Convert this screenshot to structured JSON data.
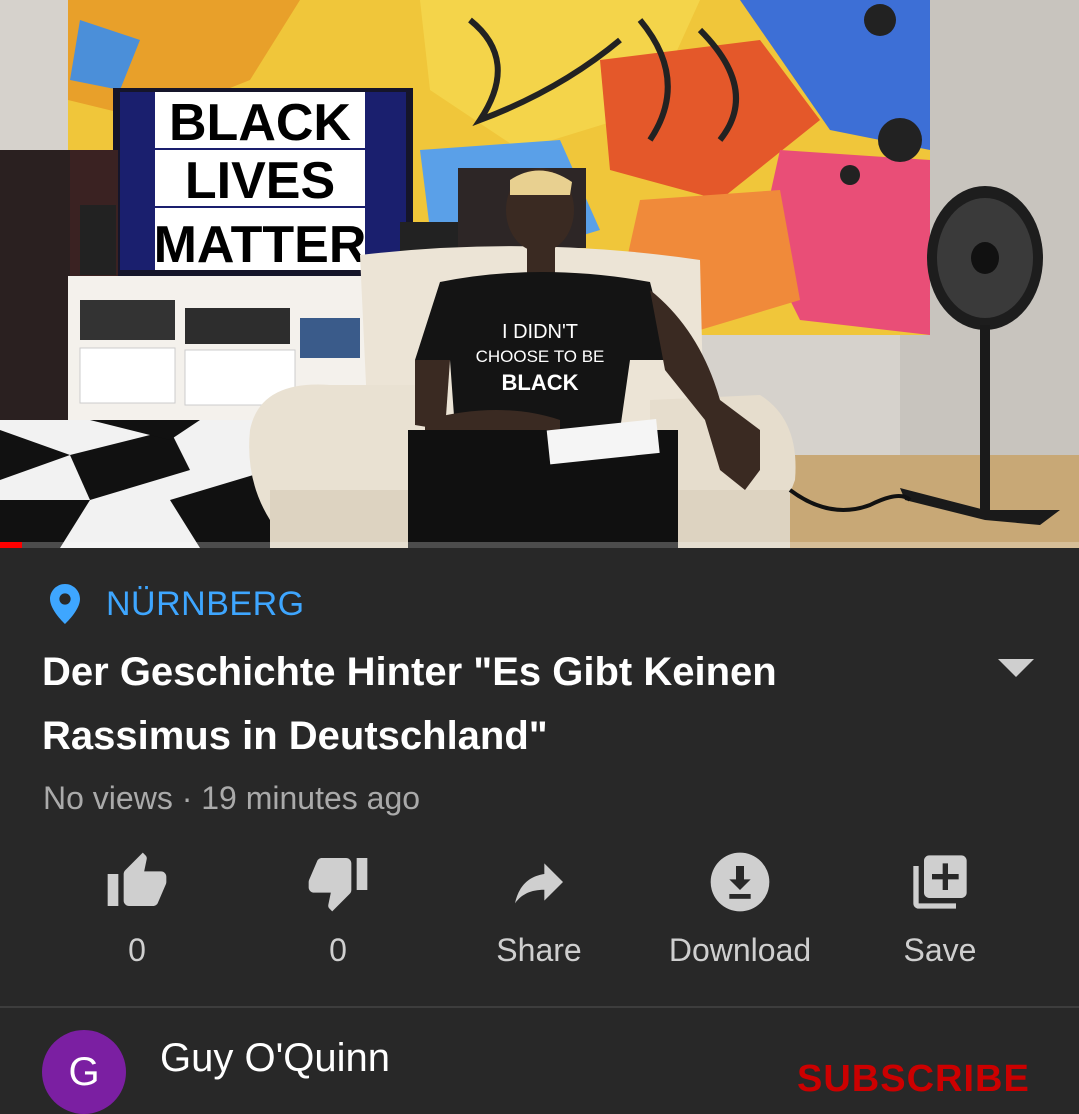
{
  "video": {
    "tv_text": [
      "BLACK",
      "LIVES",
      "MATTER"
    ],
    "shirt_text": [
      "I DIDN'T",
      "CHOOSE TO BE",
      "BLACK"
    ],
    "progress_percent": 2
  },
  "location": {
    "icon": "location-pin-icon",
    "text": "NÜRNBERG",
    "color": "#3ea6ff"
  },
  "title": "Der Geschichte Hinter \"Es Gibt Keinen Rassimus in Deutschland\"",
  "meta": "No views · 19 minutes ago",
  "actions": [
    {
      "icon": "thumbs-up-icon",
      "label": "0"
    },
    {
      "icon": "thumbs-down-icon",
      "label": "0"
    },
    {
      "icon": "share-icon",
      "label": "Share"
    },
    {
      "icon": "download-icon",
      "label": "Download"
    },
    {
      "icon": "save-playlist-icon",
      "label": "Save"
    }
  ],
  "channel": {
    "avatar_letter": "G",
    "name": "Guy O'Quinn",
    "subscribe_label": "SUBSCRIBE",
    "subscribe_color": "#cc0000"
  }
}
